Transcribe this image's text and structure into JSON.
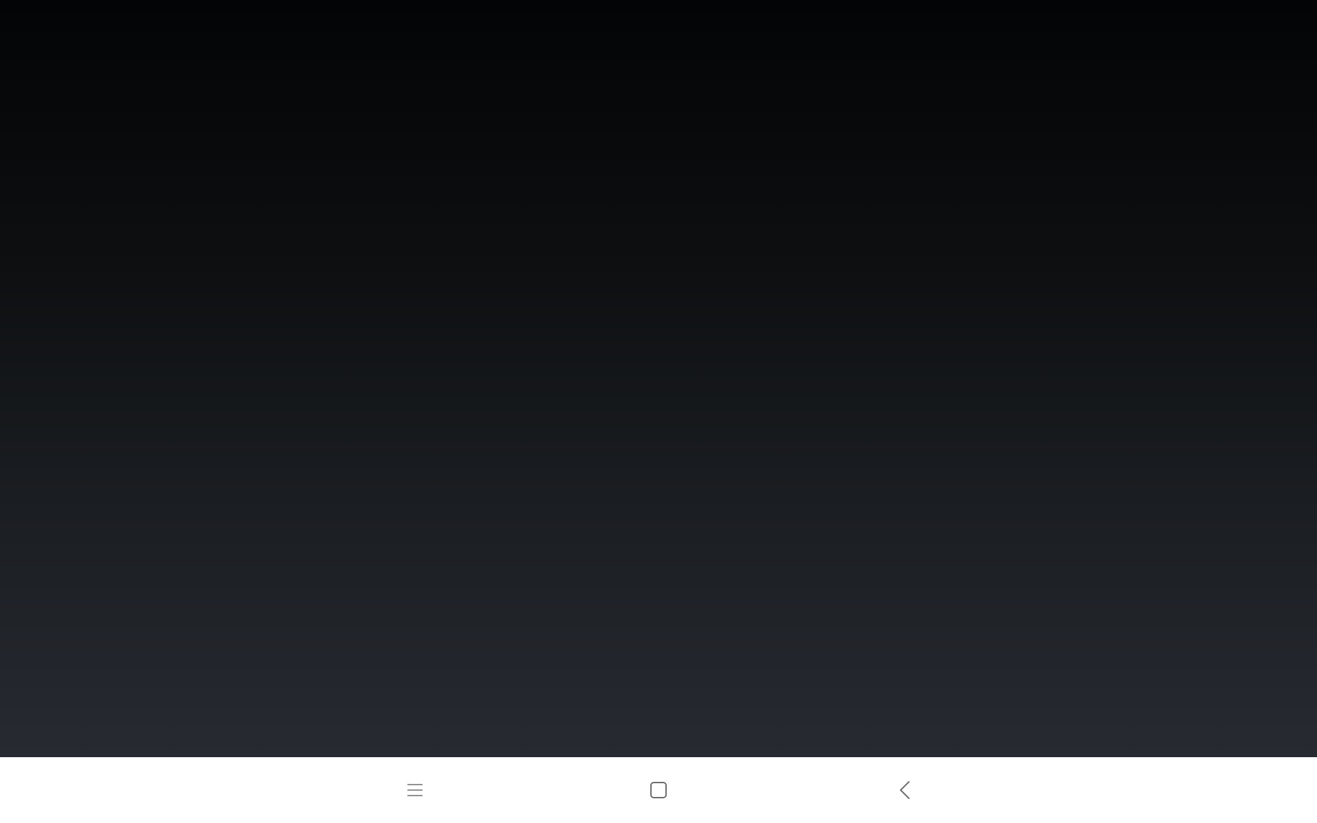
{
  "app_area": {
    "background_top": "#030405",
    "background_bottom": "#272a31"
  },
  "nav_bar": {
    "background": "#ffffff",
    "icon_color": "#6b6b6b",
    "buttons": [
      {
        "icon": "menu-icon"
      },
      {
        "icon": "home-icon"
      },
      {
        "icon": "back-icon"
      }
    ]
  }
}
